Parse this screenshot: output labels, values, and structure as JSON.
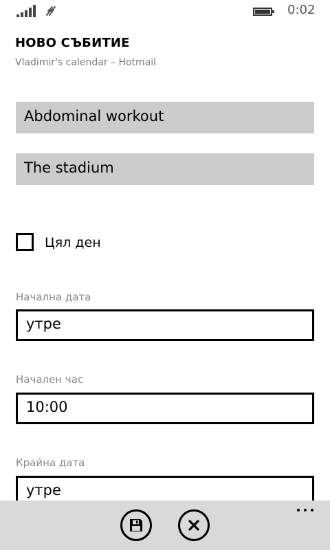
{
  "status_bar": {
    "time": "0:02",
    "icons": [
      "signal-icon",
      "network-icon",
      "battery-icon"
    ]
  },
  "header": {
    "title": "НОВО СЪБИТИЕ",
    "subtitle": "Vladimir's calendar – Hotmail"
  },
  "form": {
    "subject": "Abdominal workout",
    "location": "The stadium",
    "all_day": {
      "label": "Цял ден",
      "checked": false
    },
    "start_date": {
      "label": "Начална дата",
      "value": "утре"
    },
    "start_time": {
      "label": "Начален час",
      "value": "10:00"
    },
    "end_date": {
      "label": "Крайна дата",
      "value": "утре"
    }
  },
  "app_bar": {
    "buttons": [
      "save-icon",
      "close-icon"
    ],
    "more": "..."
  },
  "colors": {
    "input_fill": "#cccccc",
    "app_bar": "#d9d9d9",
    "label_gray": "#8a8a8a"
  }
}
